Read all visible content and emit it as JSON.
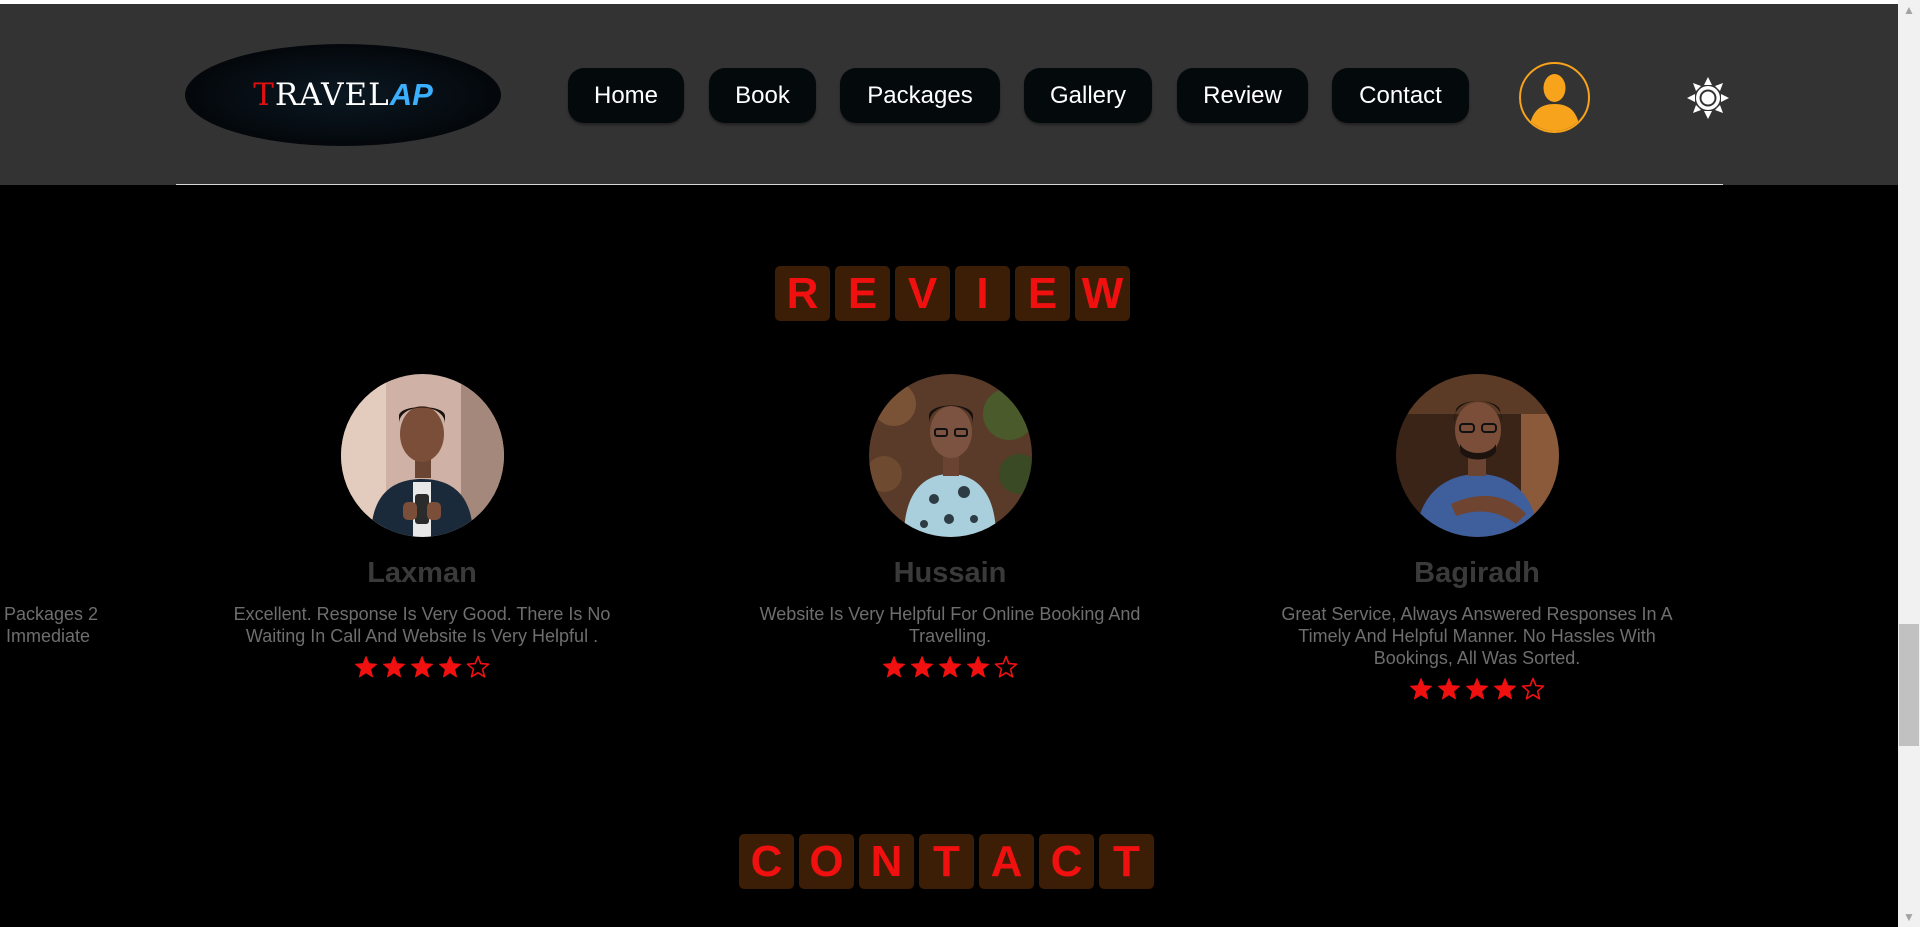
{
  "brand": {
    "logo_first_letter": "T",
    "logo_rest": "RAVEL",
    "logo_suffix": "AP"
  },
  "nav": {
    "items": [
      {
        "label": "Home"
      },
      {
        "label": "Book"
      },
      {
        "label": "Packages"
      },
      {
        "label": "Gallery"
      },
      {
        "label": "Review"
      },
      {
        "label": "Contact"
      }
    ]
  },
  "header_icons": {
    "profile": "user-avatar-icon",
    "theme": "sun-icon"
  },
  "review_section": {
    "title_letters": [
      "R",
      "E",
      "V",
      "I",
      "E",
      "W"
    ],
    "clipped_previous": {
      "line1": "Packages 2",
      "line2": "Immediate"
    },
    "reviews": [
      {
        "name": "Laxman",
        "text": "Excellent. Response Is Very Good. There Is No Waiting In Call And Website Is Very Helpful .",
        "rating": 4,
        "max_rating": 5
      },
      {
        "name": "Hussain",
        "text": "Website Is Very Helpful For Online Booking And Travelling.",
        "rating": 4,
        "max_rating": 5
      },
      {
        "name": "Bagiradh",
        "text": "Great Service, Always Answered Responses In A Timely And Helpful Manner. No Hassles With Bookings, All Was Sorted.",
        "rating": 4,
        "max_rating": 5
      }
    ]
  },
  "contact_section": {
    "title_letters": [
      "C",
      "O",
      "N",
      "T",
      "A",
      "C",
      "T"
    ]
  },
  "colors": {
    "header_bg": "#333333",
    "page_bg": "#000000",
    "nav_button_bg": "#04090c",
    "accent_red": "#f01010",
    "title_box_bg": "#3b1e05",
    "avatar_orange": "#f7a31b",
    "logo_blue": "#3ab0ff"
  }
}
